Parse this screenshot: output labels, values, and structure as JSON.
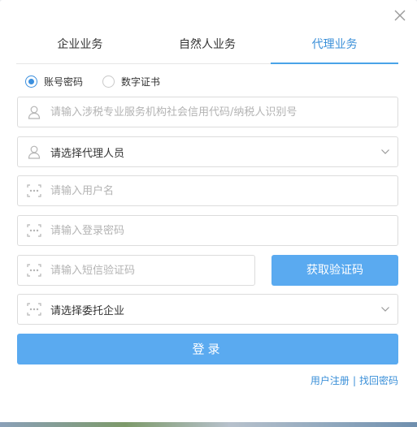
{
  "tabs": [
    {
      "label": "企业业务"
    },
    {
      "label": "自然人业务"
    },
    {
      "label": "代理业务"
    }
  ],
  "active_tab_index": 2,
  "login_method": {
    "options": [
      {
        "label": "账号密码",
        "checked": true
      },
      {
        "label": "数字证书",
        "checked": false
      }
    ]
  },
  "form": {
    "credit_code": {
      "placeholder": "请输入涉税专业服务机构社会信用代码/纳税人识别号",
      "icon": "user-icon"
    },
    "agent_person": {
      "value": "请选择代理人员",
      "icon": "user-icon"
    },
    "username": {
      "placeholder": "请输入用户名",
      "icon": "password-dots-icon"
    },
    "password": {
      "placeholder": "请输入登录密码",
      "icon": "password-dots-icon"
    },
    "sms_code": {
      "placeholder": "请输入短信验证码",
      "icon": "password-dots-icon"
    },
    "client_company": {
      "value": "请选择委托企业",
      "icon": "password-dots-icon"
    }
  },
  "buttons": {
    "get_code": "获取验证码",
    "login": "登录"
  },
  "links": {
    "register": "用户注册",
    "separator": "|",
    "retrieve_password": "找回密码"
  },
  "colors": {
    "accent": "#5aaaf0",
    "active_tab": "#3a8fd8",
    "radio_checked": "#3b8fde"
  }
}
